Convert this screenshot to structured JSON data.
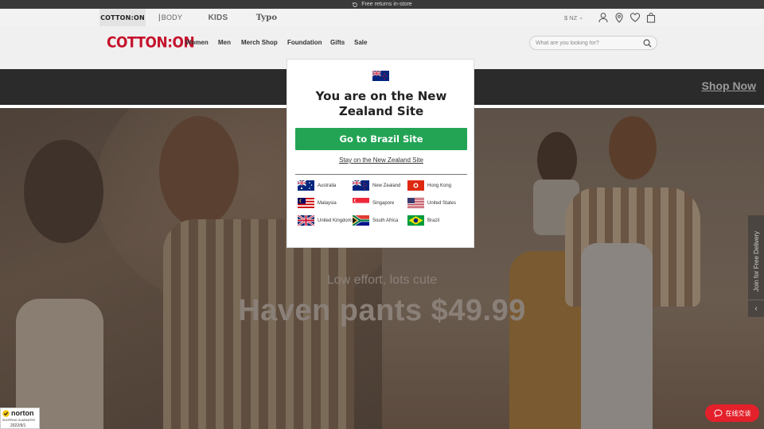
{
  "top_banner": {
    "text": "Free returns in-store"
  },
  "brands": [
    "COTTON:ON",
    "BODY",
    "KIDS",
    "Typo"
  ],
  "header": {
    "currency": "$ NZ"
  },
  "nav": {
    "logo": "COTTON:ON",
    "items": [
      "Women",
      "Men",
      "Merch Shop",
      "Foundation",
      "Gifts",
      "Sale"
    ],
    "search_placeholder": "What are you looking for?"
  },
  "promo": {
    "cta": "Shop Now"
  },
  "hero": {
    "subtitle": "Low effort, lots cute",
    "title": "Haven pants $49.99"
  },
  "side_tab": {
    "label": "Join for Free Delivery"
  },
  "modal": {
    "title": "You are on the New Zealand Site",
    "primary_button": "Go to Brazil Site",
    "stay_link": "Stay on the New Zealand Site",
    "countries": [
      "Australia",
      "New Zealand",
      "Hong Kong",
      "Malaysia",
      "Singapore",
      "United States",
      "United Kingdom",
      "South Africa",
      "Brazil"
    ]
  },
  "norton": {
    "brand": "norton",
    "tagline": "SHOPPING GUARANTEE",
    "date": "2022/9/1"
  },
  "chat": {
    "label": "在线交谈"
  },
  "colors": {
    "accent_red": "#c5122c",
    "cta_green": "#23a455",
    "chat_red": "#e4202a"
  }
}
